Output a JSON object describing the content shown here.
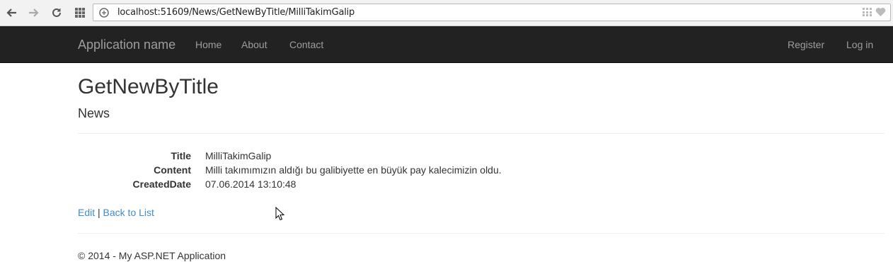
{
  "browser": {
    "url": "localhost:51609/News/GetNewByTitle/MilliTakimGalip"
  },
  "navbar": {
    "brand": "Application name",
    "left_links": [
      "Home",
      "About",
      "Contact"
    ],
    "right_links": [
      "Register",
      "Log in"
    ]
  },
  "page": {
    "title": "GetNewByTitle",
    "subtitle": "News"
  },
  "details": [
    {
      "label": "Title",
      "value": "MilliTakimGalip"
    },
    {
      "label": "Content",
      "value": "Milli takımımızın aldığı bu galibiyette en büyük pay kalecimizin oldu."
    },
    {
      "label": "CreatedDate",
      "value": "07.06.2014 13:10:48"
    }
  ],
  "actions": {
    "edit": "Edit",
    "separator": "|",
    "back": "Back to List"
  },
  "footer": {
    "text": "© 2014 - My ASP.NET Application"
  },
  "colors": {
    "navbar_bg": "#222222",
    "navbar_text": "#9d9d9d",
    "link": "#428bca"
  }
}
